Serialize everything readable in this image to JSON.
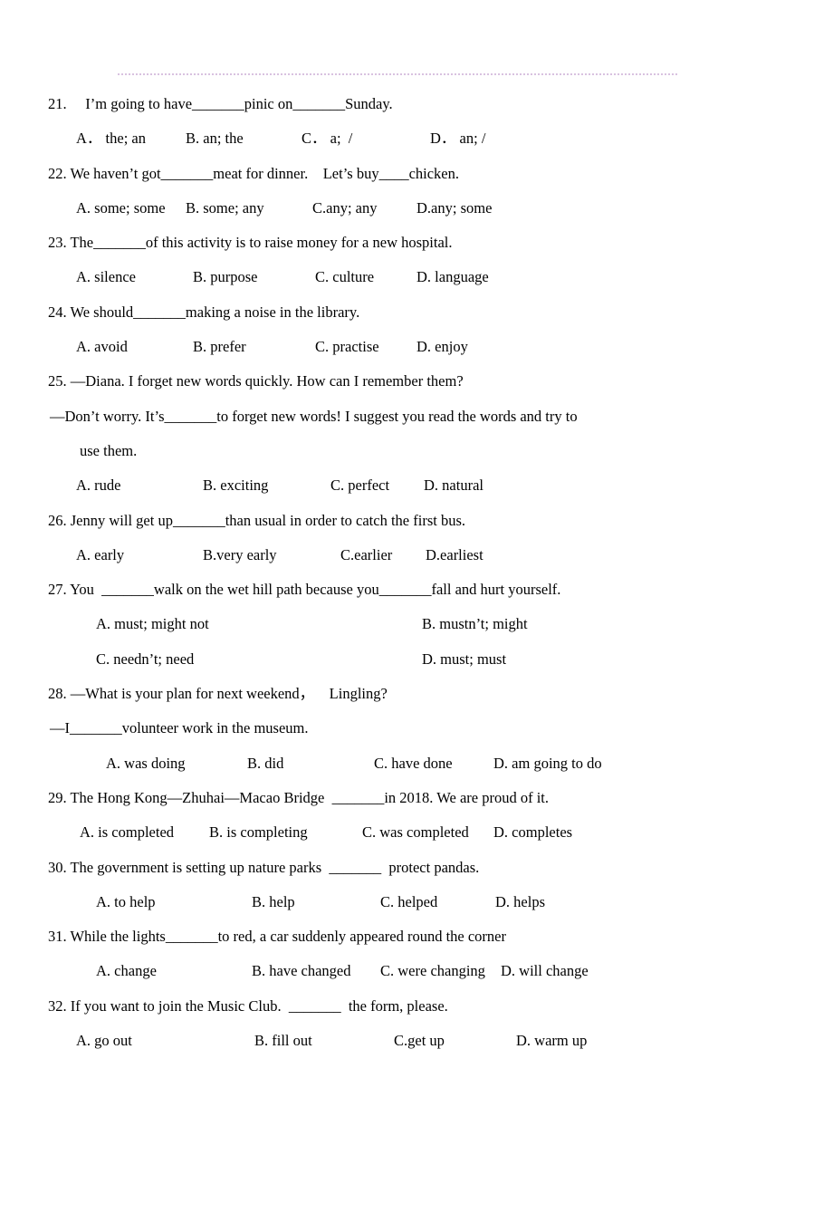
{
  "document": {
    "type": "english-multiple-choice-worksheet",
    "rule_color": "#d9c2e0"
  },
  "questions": [
    {
      "number": "21.",
      "stem_parts": [
        "I’m going to have",
        "pinic on",
        "Sunday."
      ],
      "stem_line": "21.  I’m going to have_______pinic on_______Sunday.",
      "options": [
        {
          "label": "A． the; an"
        },
        {
          "label": "B. an; the"
        },
        {
          "label": "C． a;  /"
        },
        {
          "label": "D． an; /"
        }
      ],
      "option_x": [
        84,
        205,
        333,
        475
      ]
    },
    {
      "number": "22.",
      "stem_line": "22. We haven’t got_______meat for dinner. Let’s buy____chicken.",
      "options": [
        {
          "label": "A. some; some"
        },
        {
          "label": "B. some; any"
        },
        {
          "label": "C.any; any"
        },
        {
          "label": "D.any; some"
        }
      ],
      "option_x": [
        84,
        205,
        345,
        460
      ]
    },
    {
      "number": "23.",
      "stem_line": "23. The_______of this activity is to raise money for a new hospital.",
      "options": [
        {
          "label": "A. silence"
        },
        {
          "label": "B. purpose"
        },
        {
          "label": "C. culture"
        },
        {
          "label": "D. language"
        }
      ],
      "option_x": [
        84,
        213,
        348,
        460
      ]
    },
    {
      "number": "24.",
      "stem_line": "24. We should_______making a noise in the library.",
      "options": [
        {
          "label": "A. avoid"
        },
        {
          "label": "B. prefer"
        },
        {
          "label": "C. practise"
        },
        {
          "label": "D. enjoy"
        }
      ],
      "option_x": [
        84,
        213,
        348,
        460
      ]
    },
    {
      "number": "25.",
      "stem_line": "25. —Diana. I forget new words quickly. How can I remember them?",
      "stem_line2": "—Don’t worry. It’s_______to forget new words! I suggest you read the words and try to",
      "stem_line3": "use them.",
      "options": [
        {
          "label": "A. rude"
        },
        {
          "label": "B. exciting"
        },
        {
          "label": "C. perfect"
        },
        {
          "label": "D. natural"
        }
      ],
      "option_x": [
        84,
        224,
        365,
        468
      ]
    },
    {
      "number": "26.",
      "stem_line": "26. Jenny will get up_______than usual in order to catch the first bus.",
      "options": [
        {
          "label": "A. early"
        },
        {
          "label": "B.very early"
        },
        {
          "label": "C.earlier"
        },
        {
          "label": "D.earliest"
        }
      ],
      "option_x": [
        84,
        224,
        376,
        470
      ]
    },
    {
      "number": "27.",
      "stem_line": "27. You  _______walk on the wet hill path because you_______fall and hurt yourself.",
      "options": [
        {
          "label": "A. must; might not"
        },
        {
          "label": "B. mustn’t; might"
        },
        {
          "label": "C. needn’t; need"
        },
        {
          "label": "D. must; must"
        }
      ],
      "option_x": [
        106,
        466,
        106,
        466
      ]
    },
    {
      "number": "28.",
      "stem_line": "28. —What is your plan for next weekend， Lingling?",
      "stem_line2": "—I_______volunteer work in the museum.",
      "options": [
        {
          "label": "A. was doing"
        },
        {
          "label": "B. did"
        },
        {
          "label": "C. have done"
        },
        {
          "label": "D. am going to do"
        }
      ],
      "option_x": [
        117,
        273,
        413,
        545
      ]
    },
    {
      "number": "29.",
      "stem_line": "29. The Hong Kong—Zhuhai—Macao Bridge  _______in 2018. We are proud of it.",
      "options": [
        {
          "label": "A. is completed"
        },
        {
          "label": "B. is completing"
        },
        {
          "label": "C. was completed"
        },
        {
          "label": "D. completes"
        }
      ],
      "option_x": [
        88,
        231,
        400,
        545
      ]
    },
    {
      "number": "30.",
      "stem_line": "30. The government is setting up nature parks  _______  protect pandas.",
      "options": [
        {
          "label": "A. to help"
        },
        {
          "label": "B. help"
        },
        {
          "label": "C. helped"
        },
        {
          "label": "D. helps"
        }
      ],
      "option_x": [
        106,
        278,
        420,
        547
      ]
    },
    {
      "number": "31.",
      "stem_line": "31. While the lights_______to red, a car suddenly appeared round the corner",
      "options": [
        {
          "label": "A. change"
        },
        {
          "label": "B. have changed"
        },
        {
          "label": "C. were changing"
        },
        {
          "label": "D. will change"
        }
      ],
      "option_x": [
        106,
        278,
        420,
        553
      ]
    },
    {
      "number": "32.",
      "stem_line": "32. If you want to join the Music Club.  _______  the form, please.",
      "options": [
        {
          "label": "A. go out"
        },
        {
          "label": "B. fill out"
        },
        {
          "label": "C.get up"
        },
        {
          "label": "D. warm up"
        }
      ],
      "option_x": [
        84,
        281,
        435,
        570
      ]
    }
  ]
}
